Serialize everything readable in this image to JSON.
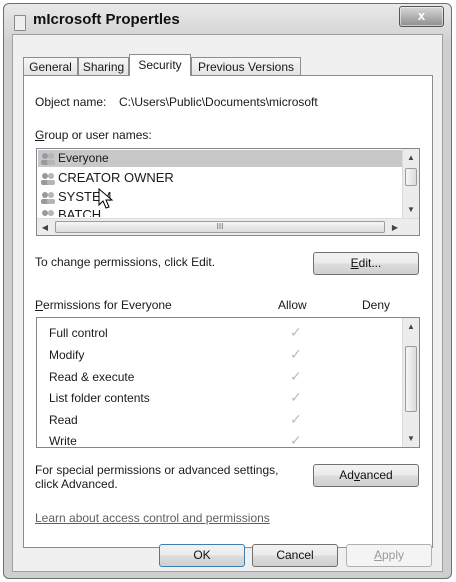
{
  "window": {
    "title": "mIcrosoft Propertles",
    "close_label": "x"
  },
  "tabs": [
    {
      "label": "General"
    },
    {
      "label": "Sharing"
    },
    {
      "label": "Security"
    },
    {
      "label": "Previous Versions"
    }
  ],
  "security": {
    "object_name_label": "Object name:",
    "object_name_value": "C:\\Users\\Public\\Documents\\microsoft",
    "group_label": "Group or user names:",
    "users": [
      {
        "name": "Everyone"
      },
      {
        "name": "CREATOR OWNER"
      },
      {
        "name": "SYSTEM"
      },
      {
        "name": "BATCH"
      }
    ],
    "hscroll_thumb_glyph": "III",
    "change_text": "To change permissions, click Edit.",
    "edit_label": "Edit...",
    "permissions_label": "Permissions for Everyone",
    "allow_header": "Allow",
    "deny_header": "Deny",
    "permissions": [
      {
        "name": "Full control"
      },
      {
        "name": "Modify"
      },
      {
        "name": "Read & execute"
      },
      {
        "name": "List folder contents"
      },
      {
        "name": "Read"
      },
      {
        "name": "Write"
      }
    ],
    "check_glyph": "✓",
    "special_text_1": "For special permissions or advanced settings,",
    "special_text_2": "click Advanced.",
    "advanced_label": "Advanced",
    "learn_link": "Learn about access control and permissions"
  },
  "footer": {
    "ok_label": "OK",
    "cancel_label": "Cancel",
    "apply_label": "Apply"
  }
}
